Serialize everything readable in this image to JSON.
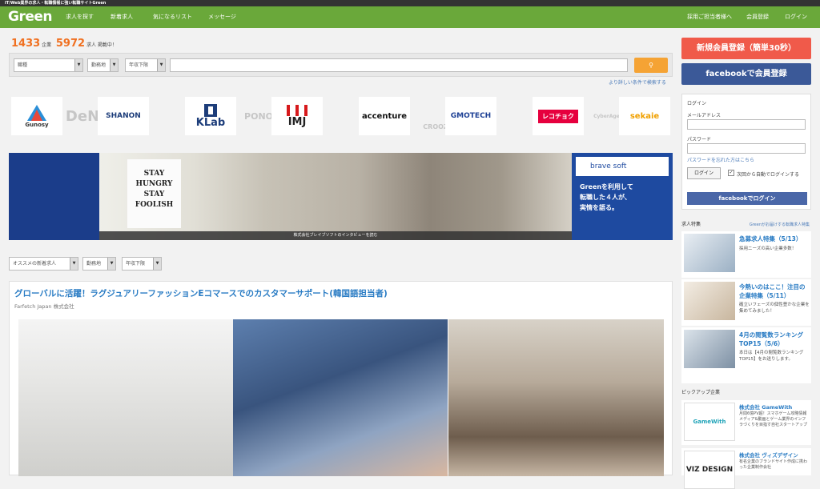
{
  "topbar": {
    "tagline": "IT/Web業界の求人・転職情報に強い転職サイトGreen"
  },
  "nav": {
    "logo": "Green",
    "links": [
      "求人を探す",
      "新着求人",
      "気になるリスト",
      "メッセージ"
    ],
    "right_links": [
      "採用ご担当者様へ",
      "会員登録",
      "ログイン"
    ]
  },
  "stats": {
    "companies": "1433",
    "companies_unit": "企業",
    "jobs": "5972",
    "jobs_unit": "求人 掲載中！"
  },
  "search": {
    "occupation": "職種",
    "location": "勤務地",
    "salary": "年収下限",
    "advanced_link": "より詳しい条件で検索する"
  },
  "company_logos": [
    "Gunosy",
    "DeNA",
    "SHANON",
    "KLab",
    "PONOS",
    "IMJ",
    "accenture",
    "CROOZ",
    "GMOTECH",
    "レコチョク",
    "CyberAgent",
    "sekaie"
  ],
  "banner": {
    "poster_lines": [
      "STAY",
      "HUNGRY",
      "STAY",
      "FOOLISH"
    ],
    "caption": "株式会社ブレイブソフトのインタビューを読む",
    "company": "brave soft",
    "lines": [
      "Greenを利用して",
      "転職した４人が、",
      "実情を語る。"
    ]
  },
  "filters": {
    "recommended": "オススメの新着求人",
    "location": "勤務地",
    "salary": "年収下限"
  },
  "job": {
    "title": "グローバルに活躍！ラグジュアリーファッションEコマースでのカスタマーサポート(韓国語担当者)",
    "company": "Farfetch Japan 株式会社"
  },
  "sidebar": {
    "register": "新規会員登録（簡単30秒）",
    "facebook_register": "facebookで会員登録",
    "login": {
      "heading": "ログイン",
      "email_label": "メールアドレス",
      "password_label": "パスワード",
      "forgot": "パスワードを忘れた方はこちら",
      "button": "ログイン",
      "remember": "次回から自動でログインする",
      "facebook_login": "facebookでログイン"
    },
    "features_heading": "求人特集",
    "features_link": "Greenがお届けする転職求人特集",
    "features": [
      {
        "title": "急募求人特集（5/13）",
        "desc": "採用ニーズの高い企業多数！"
      },
      {
        "title": "今熱いのはここ！注目の企業特集（5/11）",
        "desc": "確立いフェーズの個性豊かな企業を集めてみました！"
      },
      {
        "title": "4月の閲覧数ランキングTOP15（5/6）",
        "desc": "本日は【4月の閲覧数ランキングTOP15】をお送りします。"
      }
    ],
    "pickup_heading": "ピックアップ企業",
    "pickup": [
      {
        "logo": "GameWith",
        "name": "株式会社 GameWith",
        "desc": "月間6億PV超！スマホゲーム攻略情報メディア&動画とゲーム業界のインフラづくりを目指す自社スタートアップ"
      },
      {
        "logo": "VIZ DESIGN",
        "name": "株式会社 ヴィズデザイン",
        "desc": "有名企業のブランドサイト作成に携わった企業制作会社"
      }
    ]
  }
}
